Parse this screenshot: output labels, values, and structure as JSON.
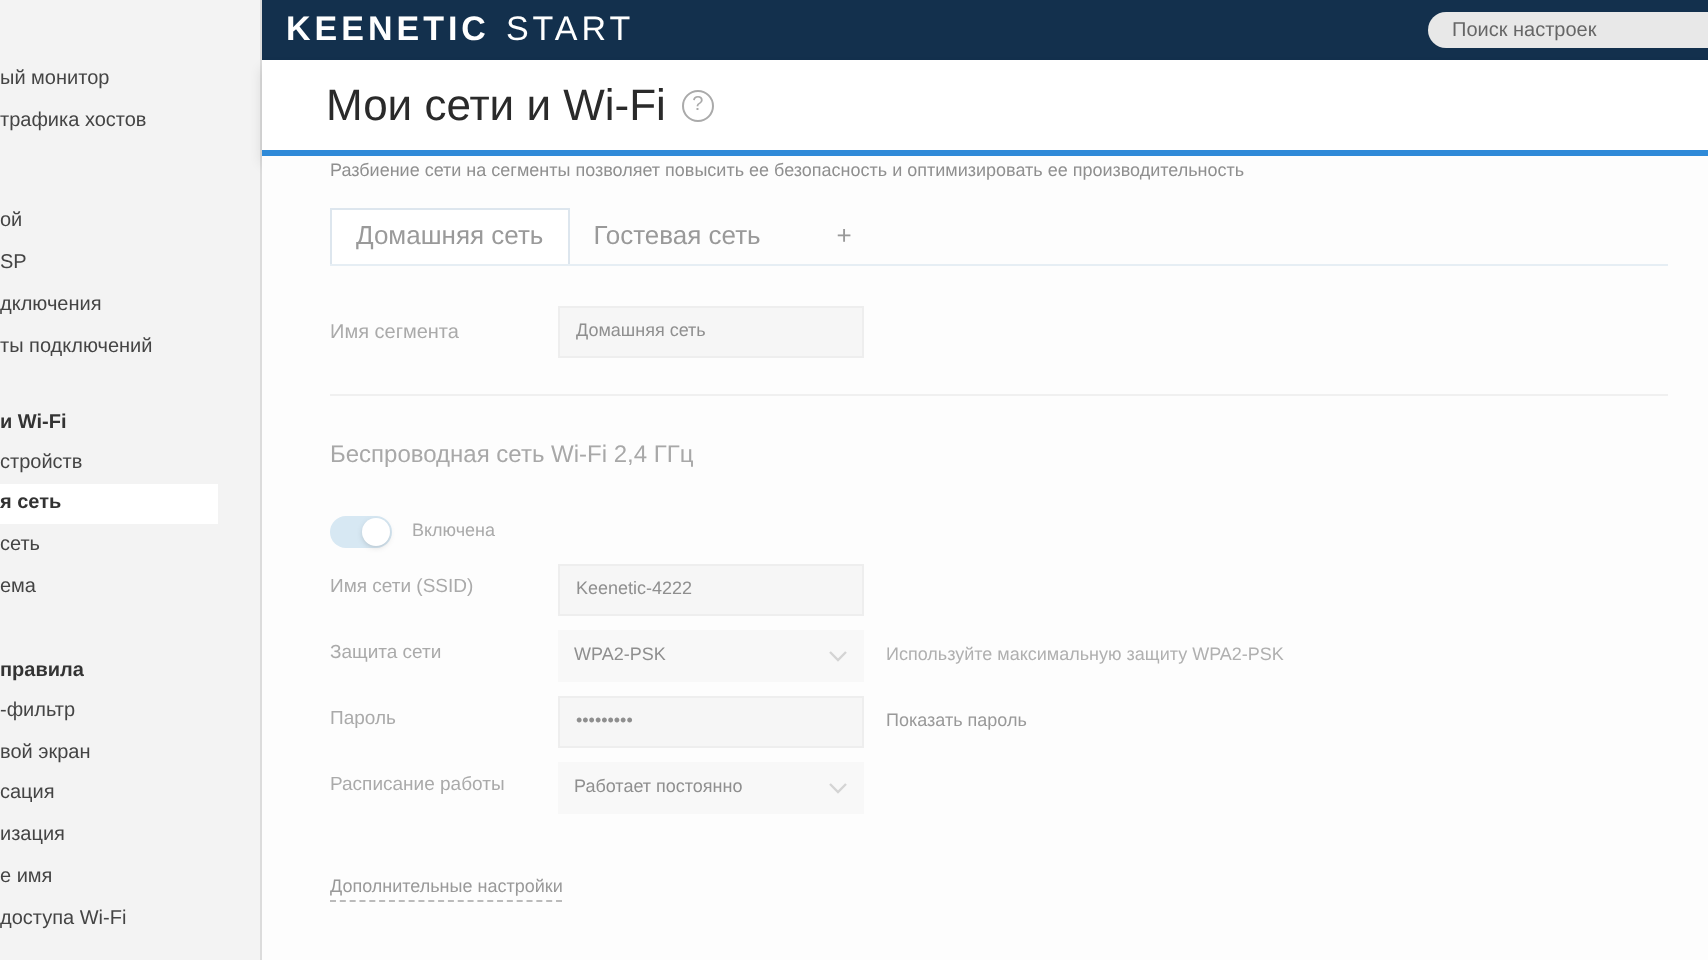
{
  "sidebar": {
    "sections": [
      {
        "items": [
          {
            "label": "ый монитор",
            "selected": false
          },
          {
            "label": "трафика хостов",
            "selected": false
          }
        ]
      },
      {
        "items": [
          {
            "label": "ой",
            "selected": false
          },
          {
            "label": "SP",
            "selected": false
          },
          {
            "label": "дключения",
            "selected": false
          },
          {
            "label": "ты подключений",
            "selected": false
          }
        ]
      },
      {
        "heading": "и Wi-Fi",
        "items": [
          {
            "label": "стройств",
            "selected": false
          },
          {
            "label": "я сеть",
            "selected": true
          },
          {
            "label": "сеть",
            "selected": false
          },
          {
            "label": "ема",
            "selected": false
          }
        ]
      },
      {
        "heading": "правила",
        "items": [
          {
            "label": "-фильтр",
            "selected": false
          },
          {
            "label": "вой экран",
            "selected": false
          },
          {
            "label": "сация",
            "selected": false
          },
          {
            "label": "изация",
            "selected": false
          },
          {
            "label": "е имя",
            "selected": false
          },
          {
            "label": "доступа Wi-Fi",
            "selected": false
          }
        ]
      }
    ]
  },
  "header": {
    "logo_brand": "KEENETIC",
    "logo_model": "START",
    "search": {
      "placeholder": "Поиск настроек"
    }
  },
  "page": {
    "title": "Мои сети и Wi-Fi",
    "help": "?",
    "description": "Разбиение сети на сегменты позволяет повысить ее безопасность и оптимизировать ее производительность",
    "tabs": [
      {
        "label": "Домашняя сеть",
        "selected": true
      },
      {
        "label": "Гостевая сеть",
        "selected": false
      }
    ],
    "add_tab": "+",
    "segment": {
      "label": "Имя сегмента",
      "value": "Домашняя сеть"
    },
    "wifi": {
      "title": "Беспроводная сеть Wi-Fi 2,4 ГГц",
      "enabled": {
        "on": true,
        "label": "Включена"
      },
      "fields": [
        {
          "kind": "input",
          "label": "Имя сети (SSID)",
          "value": "Keenetic-4222"
        },
        {
          "kind": "select",
          "label": "Защита сети",
          "value": "WPA2-PSK",
          "hint": "Используйте максимальную защиту WPA2-PSK"
        },
        {
          "kind": "input",
          "label": "Пароль",
          "value": "•••••••••",
          "link": "Показать пароль"
        },
        {
          "kind": "select",
          "label": "Расписание работы",
          "value": "Работает постоянно"
        }
      ]
    },
    "more_link": "Дополнительные настройки"
  }
}
